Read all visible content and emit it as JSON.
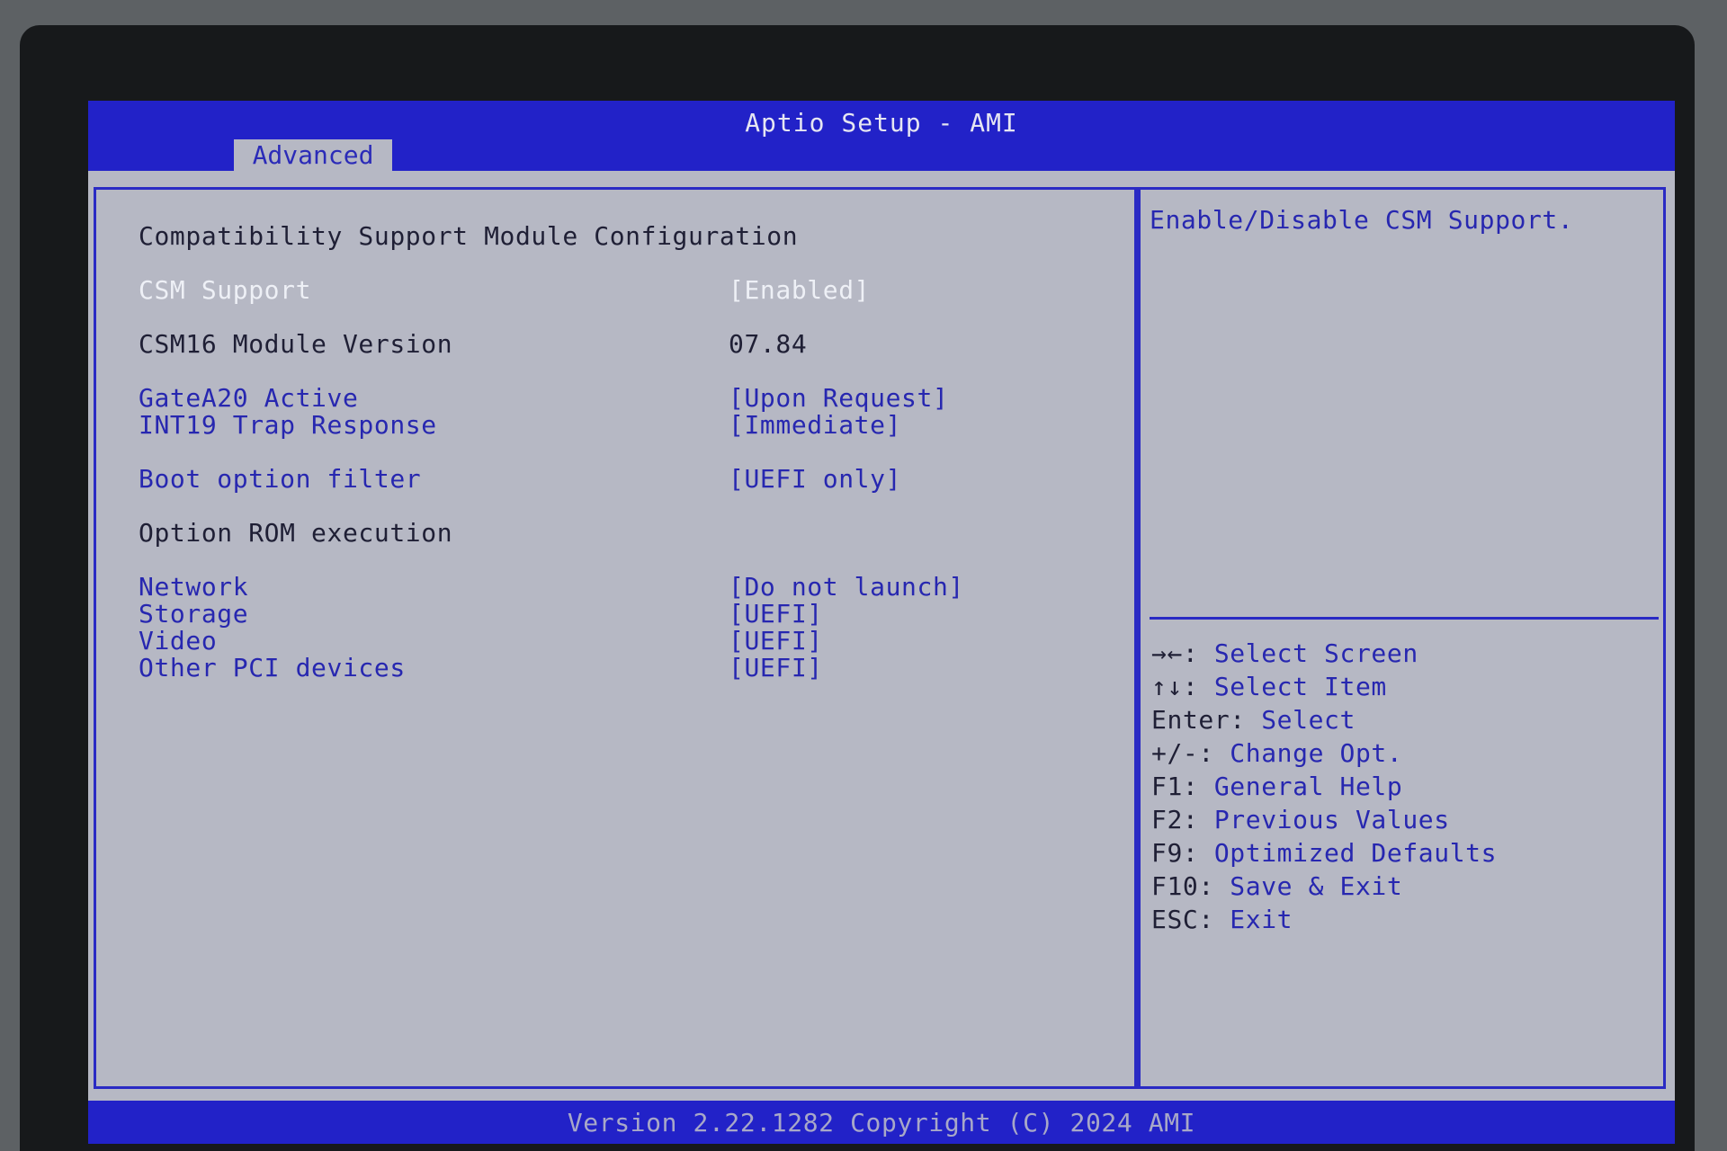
{
  "header": {
    "title": "Aptio Setup - AMI",
    "active_tab": "Advanced"
  },
  "main": {
    "page_title": "Compatibility Support Module Configuration",
    "items": [
      {
        "label": "CSM Support",
        "value": "[Enabled]"
      },
      {
        "label": "CSM16 Module Version",
        "value": "07.84"
      },
      {
        "label": "GateA20 Active",
        "value": "[Upon Request]"
      },
      {
        "label": "INT19 Trap Response",
        "value": "[Immediate]"
      },
      {
        "label": "Boot option filter",
        "value": "[UEFI only]"
      },
      {
        "label": "Option ROM execution",
        "value": ""
      },
      {
        "label": "Network",
        "value": "[Do not launch]"
      },
      {
        "label": "Storage",
        "value": "[UEFI]"
      },
      {
        "label": "Video",
        "value": "[UEFI]"
      },
      {
        "label": "Other PCI devices",
        "value": "[UEFI]"
      }
    ]
  },
  "help": {
    "description": "Enable/Disable CSM Support.",
    "keys": [
      {
        "key": "→←:",
        "desc": " Select Screen"
      },
      {
        "key": "↑↓:",
        "desc": " Select Item"
      },
      {
        "key": "Enter:",
        "desc": " Select"
      },
      {
        "key": "+/-:",
        "desc": " Change Opt."
      },
      {
        "key": "F1:",
        "desc": " General Help"
      },
      {
        "key": "F2:",
        "desc": " Previous Values"
      },
      {
        "key": "F9:",
        "desc": " Optimized Defaults"
      },
      {
        "key": "F10:",
        "desc": " Save & Exit"
      },
      {
        "key": "ESC:",
        "desc": " Exit"
      }
    ]
  },
  "footer": {
    "text": "Version 2.22.1282 Copyright (C) 2024 AMI"
  },
  "colors": {
    "header_blue": "#2222c8",
    "panel_bg": "#b6b8c4",
    "item_text": "#2727b0",
    "highlight_text": "#eef0f6",
    "static_text": "#1f1f35"
  }
}
